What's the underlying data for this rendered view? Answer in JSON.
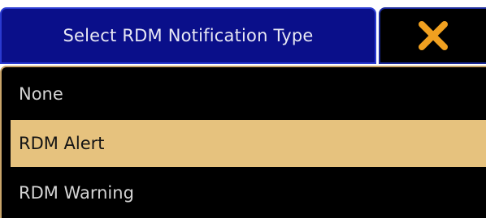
{
  "dialog": {
    "title": "Select RDM Notification Type",
    "close_icon": "close-x-icon"
  },
  "colors": {
    "title_bg": "#0a0f8a",
    "title_border": "#2a3ad0",
    "close_icon": "#f0a020",
    "panel_border": "#c8a46a",
    "selected_bg": "#e6c27e"
  },
  "options": [
    {
      "label": "None",
      "selected": false
    },
    {
      "label": "RDM Alert",
      "selected": true
    },
    {
      "label": "RDM Warning",
      "selected": false
    }
  ]
}
